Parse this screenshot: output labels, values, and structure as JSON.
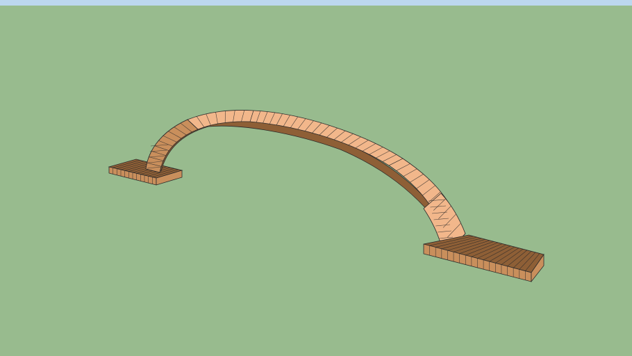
{
  "scene": {
    "sky_color": "#bcd7ef",
    "ground_color": "#98bb8e",
    "model": {
      "object": "brick-arch-bridge",
      "brick_top_color": "#f2b78b",
      "brick_side_color": "#c98f5c",
      "brick_dark_color": "#8e5f36",
      "edge_color": "#2a2a2a"
    }
  }
}
